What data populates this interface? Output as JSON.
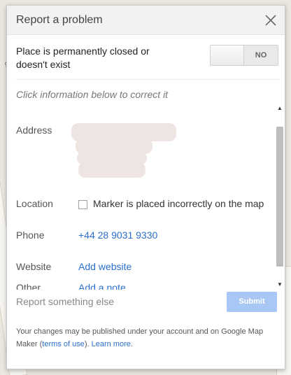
{
  "dialog": {
    "title": "Report a problem",
    "closed_question": "Place is permanently closed or doesn't exist",
    "toggle_state": "NO",
    "hint": "Click information below to correct it",
    "fields": {
      "address_label": "Address",
      "location_label": "Location",
      "location_checkbox_label": "Marker is placed incorrectly on the map",
      "phone_label": "Phone",
      "phone_value": "+44 28 9031 9330",
      "website_label": "Website",
      "website_value": "Add website",
      "other_label": "Other",
      "other_value": "Add a note"
    },
    "report_else": "Report something else",
    "submit_label": "Submit",
    "disclaimer_pre": "Your changes may be published under your account and on Google Map Maker (",
    "terms_link": "terms of use",
    "disclaimer_mid": "). ",
    "learn_more_link": "Learn more",
    "disclaimer_post": "."
  },
  "map": {
    "street_text": "ers St"
  },
  "colors": {
    "link": "#2a6fce",
    "submit_disabled": "#a8c7f4",
    "header_bg": "#f2f2f2"
  }
}
